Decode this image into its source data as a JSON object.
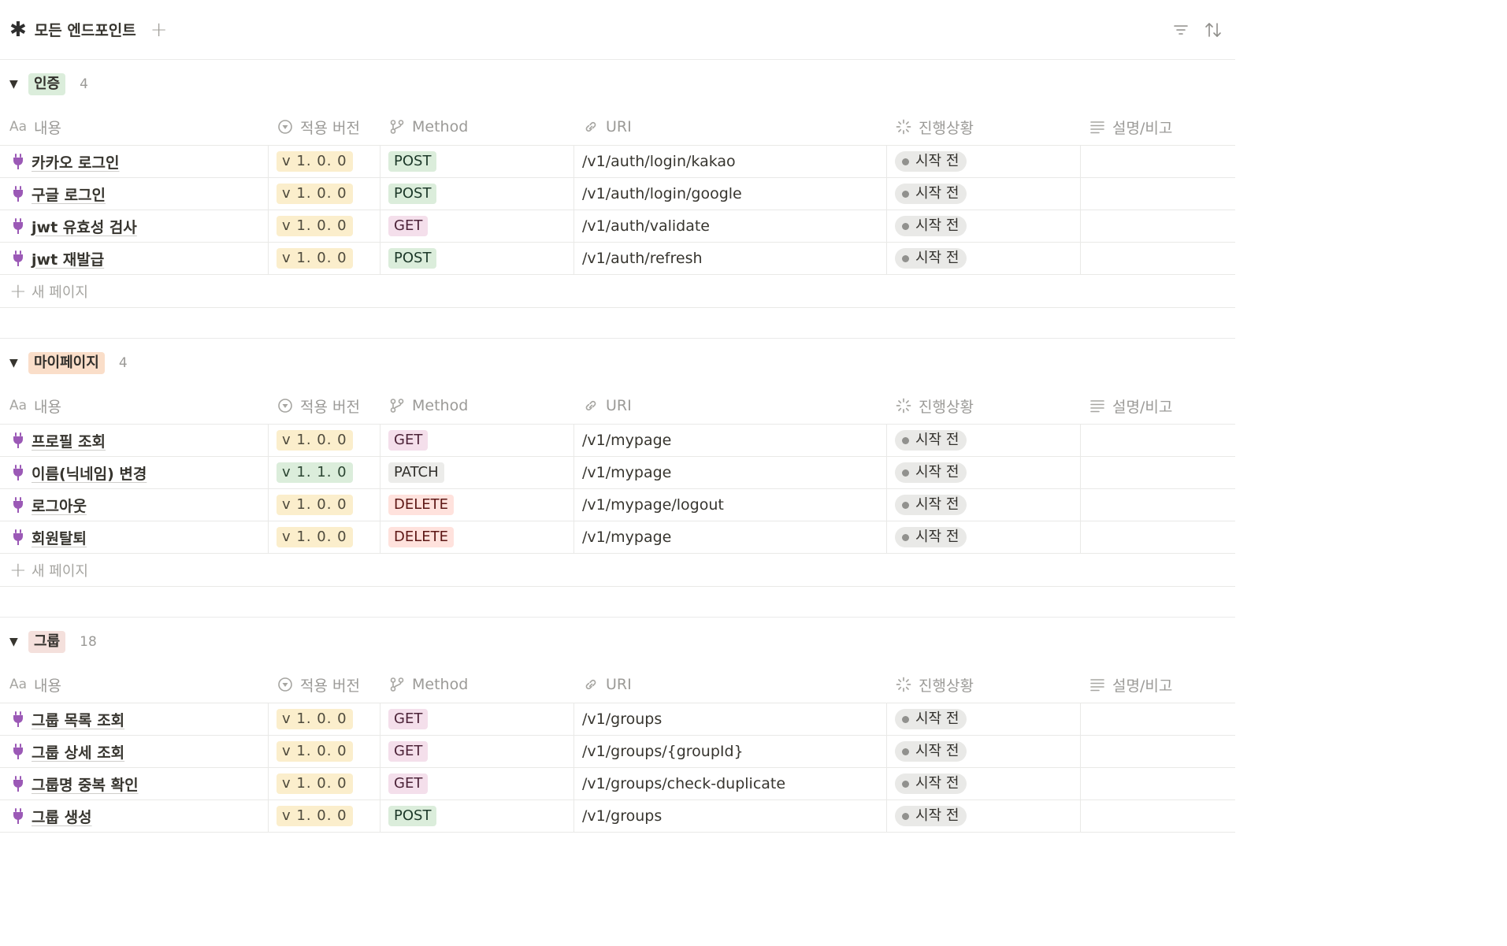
{
  "view": {
    "title": "모든 엔드포인트",
    "icon": "asterisk-icon",
    "add_label": "+"
  },
  "columns": {
    "title": "내용",
    "title_prefix": "Aa",
    "version": "적용 버전",
    "method": "Method",
    "uri": "URI",
    "status": "진행상황",
    "note": "설명/비고"
  },
  "new_page_label": "새 페이지",
  "groups": [
    {
      "name": "인증",
      "count": "4",
      "color": "#dbeddb",
      "rows": [
        {
          "title": "카카오 로그인",
          "version": "v 1. 0. 0",
          "method": "POST",
          "uri": "/v1/auth/login/kakao",
          "status": "시작 전",
          "note": ""
        },
        {
          "title": "구글 로그인",
          "version": "v 1. 0. 0",
          "method": "POST",
          "uri": "/v1/auth/login/google",
          "status": "시작 전",
          "note": ""
        },
        {
          "title": "jwt 유효성 검사",
          "version": "v 1. 0. 0",
          "method": "GET",
          "uri": "/v1/auth/validate",
          "status": "시작 전",
          "note": ""
        },
        {
          "title": "jwt 재발급",
          "version": "v 1. 0. 0",
          "method": "POST",
          "uri": "/v1/auth/refresh",
          "status": "시작 전",
          "note": ""
        }
      ]
    },
    {
      "name": "마이페이지",
      "count": "4",
      "color": "#fadec9",
      "rows": [
        {
          "title": "프로필 조회",
          "version": "v 1. 0. 0",
          "method": "GET",
          "uri": "/v1/mypage",
          "status": "시작 전",
          "note": ""
        },
        {
          "title": "이름(닉네임) 변경",
          "version": "v 1. 1. 0",
          "method": "PATCH",
          "uri": "/v1/mypage",
          "status": "시작 전",
          "note": ""
        },
        {
          "title": "로그아웃",
          "version": "v 1. 0. 0",
          "method": "DELETE",
          "uri": "/v1/mypage/logout",
          "status": "시작 전",
          "note": ""
        },
        {
          "title": "회원탈퇴",
          "version": "v 1. 0. 0",
          "method": "DELETE",
          "uri": "/v1/mypage",
          "status": "시작 전",
          "note": ""
        }
      ]
    },
    {
      "name": "그룹",
      "count": "18",
      "color": "#f4e0dc",
      "rows": [
        {
          "title": "그룹 목록 조회",
          "version": "v 1. 0. 0",
          "method": "GET",
          "uri": "/v1/groups",
          "status": "시작 전",
          "note": ""
        },
        {
          "title": "그룹 상세 조회",
          "version": "v 1. 0. 0",
          "method": "GET",
          "uri": "/v1/groups/{groupId}",
          "status": "시작 전",
          "note": ""
        },
        {
          "title": "그룹명 중복 확인",
          "version": "v 1. 0. 0",
          "method": "GET",
          "uri": "/v1/groups/check-duplicate",
          "status": "시작 전",
          "note": ""
        },
        {
          "title": "그룹 생성",
          "version": "v 1. 0. 0",
          "method": "POST",
          "uri": "/v1/groups",
          "status": "시작 전",
          "note": ""
        }
      ]
    }
  ]
}
